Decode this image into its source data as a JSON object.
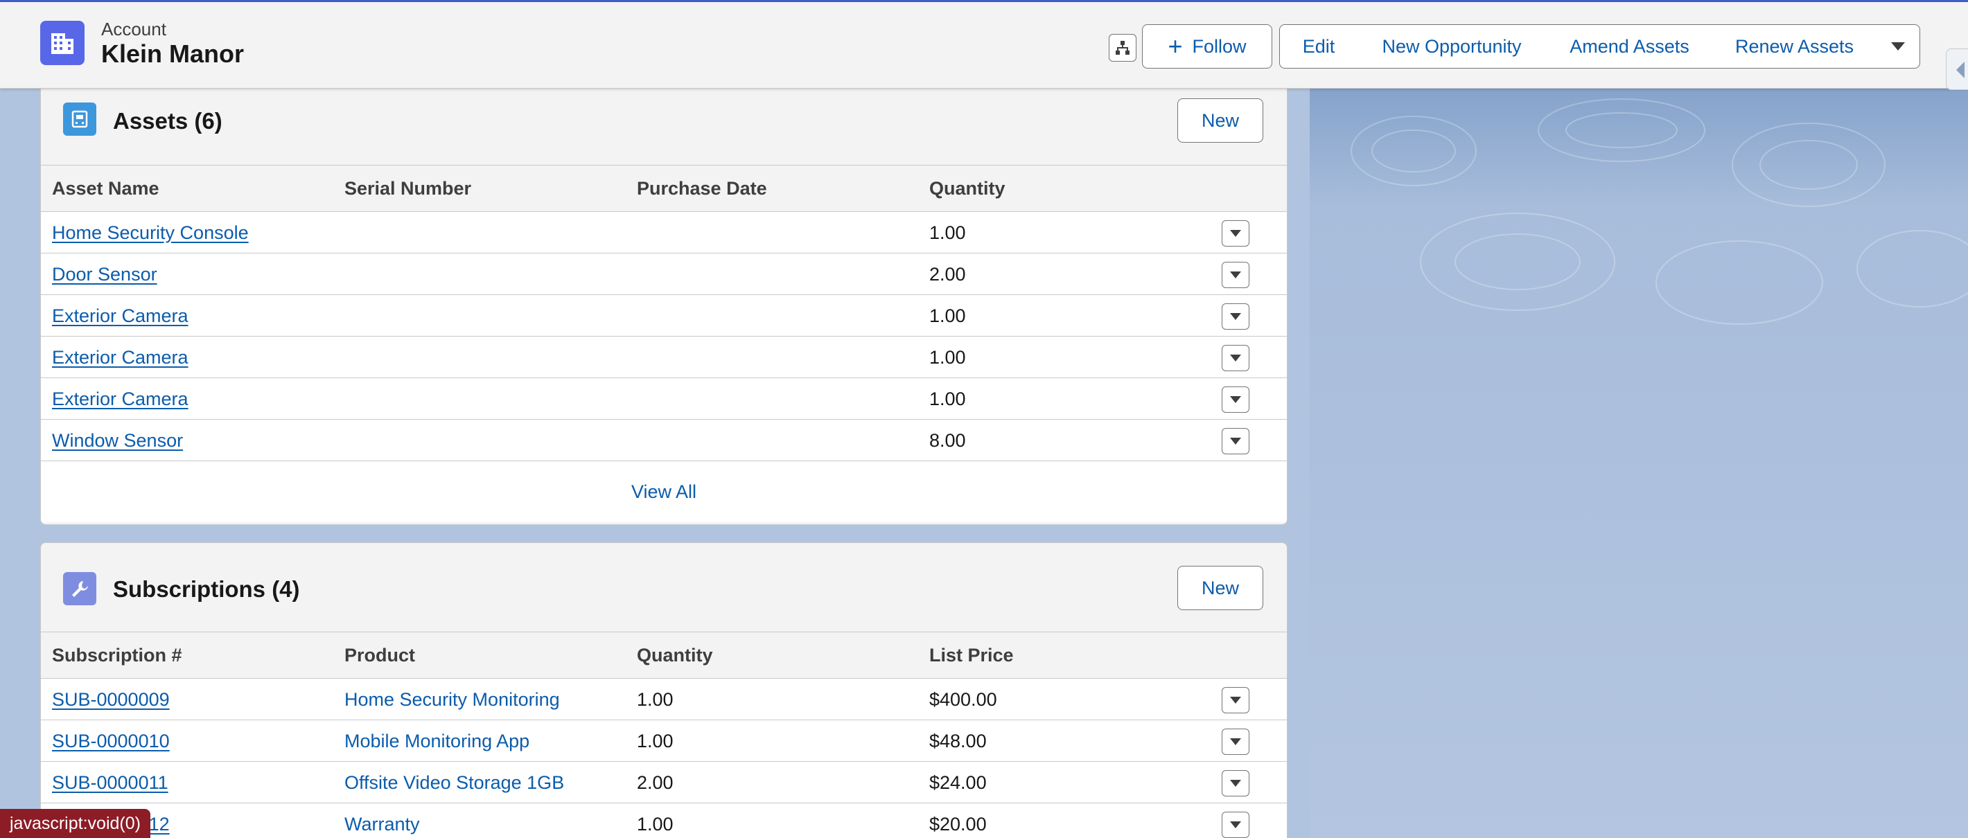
{
  "header": {
    "object_label": "Account",
    "record_name": "Klein Manor",
    "buttons": {
      "follow": "Follow",
      "edit": "Edit",
      "new_opportunity": "New Opportunity",
      "amend_assets": "Amend Assets",
      "renew_assets": "Renew Assets"
    }
  },
  "assets": {
    "title": "Assets (6)",
    "new_label": "New",
    "columns": [
      "Asset Name",
      "Serial Number",
      "Purchase Date",
      "Quantity"
    ],
    "rows": [
      {
        "name": "Home Security Console",
        "serial": "",
        "purchase_date": "",
        "quantity": "1.00"
      },
      {
        "name": "Door Sensor",
        "serial": "",
        "purchase_date": "",
        "quantity": "2.00"
      },
      {
        "name": "Exterior Camera",
        "serial": "",
        "purchase_date": "",
        "quantity": "1.00"
      },
      {
        "name": "Exterior Camera",
        "serial": "",
        "purchase_date": "",
        "quantity": "1.00"
      },
      {
        "name": "Exterior Camera",
        "serial": "",
        "purchase_date": "",
        "quantity": "1.00"
      },
      {
        "name": "Window Sensor",
        "serial": "",
        "purchase_date": "",
        "quantity": "8.00"
      }
    ],
    "view_all": "View All"
  },
  "subscriptions": {
    "title": "Subscriptions (4)",
    "new_label": "New",
    "columns": [
      "Subscription #",
      "Product",
      "Quantity",
      "List Price"
    ],
    "rows": [
      {
        "number": "SUB-0000009",
        "product": "Home Security Monitoring",
        "quantity": "1.00",
        "list_price": "$400.00"
      },
      {
        "number": "SUB-0000010",
        "product": "Mobile Monitoring App",
        "quantity": "1.00",
        "list_price": "$48.00"
      },
      {
        "number": "SUB-0000011",
        "product": "Offsite Video Storage 1GB",
        "quantity": "2.00",
        "list_price": "$24.00"
      },
      {
        "number": "SUB-0000012",
        "product": "Warranty",
        "quantity": "1.00",
        "list_price": "$20.00"
      }
    ]
  },
  "status_bar": "javascript:void(0)",
  "colors": {
    "brand_blue": "#0b5cab",
    "account_icon": "#5867e8",
    "assets_icon": "#3c97dd",
    "subscriptions_icon": "#7f8de1",
    "status_bar": "#8c1c26"
  },
  "icons": {
    "account": "building-icon",
    "hierarchy": "hierarchy-icon",
    "assets": "asset-icon",
    "subscriptions": "wrench-icon",
    "row_action": "chevron-down-icon"
  }
}
